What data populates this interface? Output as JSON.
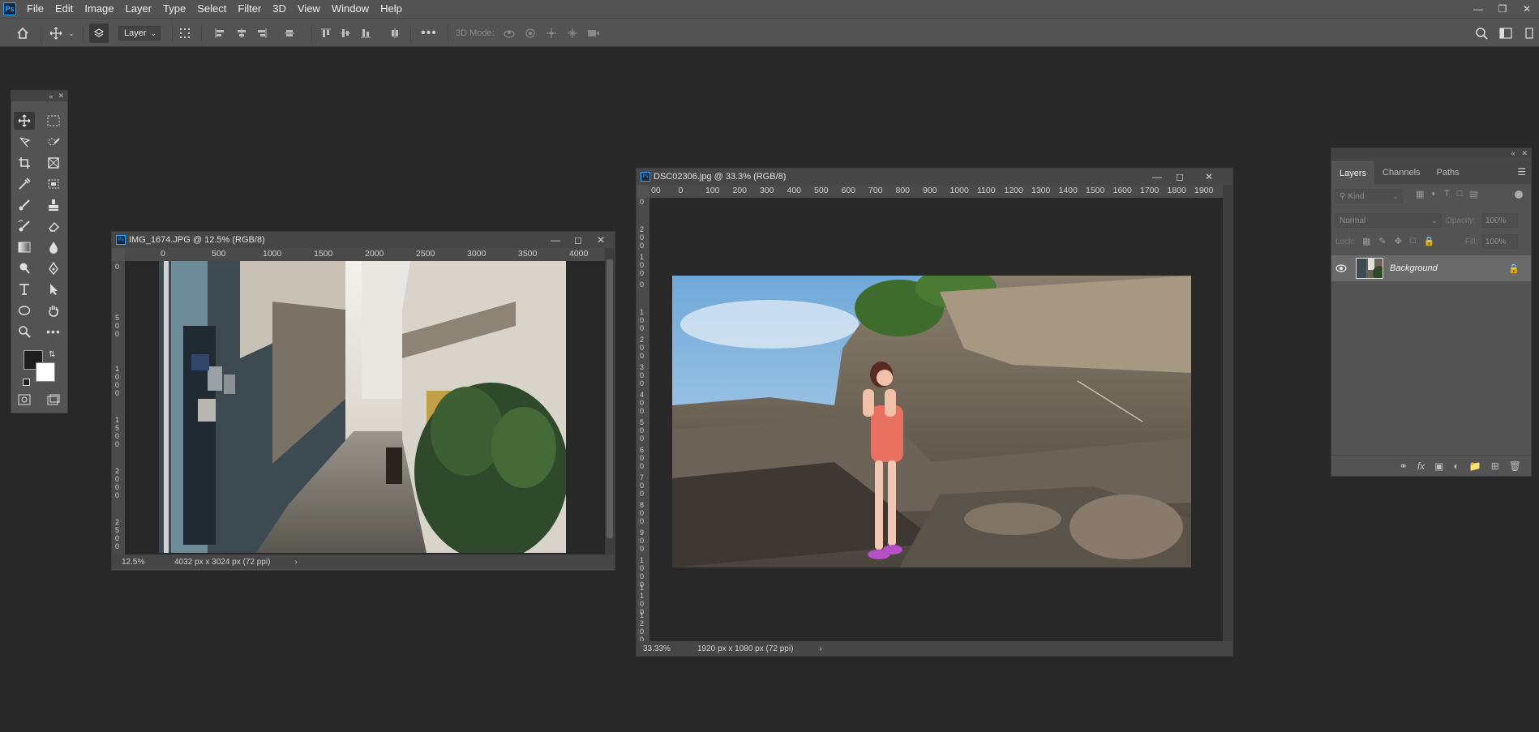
{
  "app": {
    "logo": "Ps"
  },
  "menu": [
    "File",
    "Edit",
    "Image",
    "Layer",
    "Type",
    "Select",
    "Filter",
    "3D",
    "View",
    "Window",
    "Help"
  ],
  "window_controls": [
    "minimize-icon",
    "restore-icon",
    "close-icon"
  ],
  "options_bar": {
    "auto_select_target": "Layer",
    "three_d_mode_label": "3D Mode:",
    "icons": [
      "home-icon",
      "move-icon",
      "layers-auto-select-icon",
      "distribute-icon",
      "align-left-icon",
      "align-horizontal-center-icon",
      "align-right-icon",
      "align-top-icon",
      "align-vertical-center-icon",
      "align-bottom-icon",
      "more-icon",
      "orbit-3d-icon",
      "roll-3d-icon",
      "pan-3d-icon",
      "slide-3d-icon",
      "scale-3d-icon",
      "search-icon",
      "workspace-icon"
    ]
  },
  "toolbox": {
    "tools": [
      "move-tool",
      "marquee-tool",
      "lasso-tool",
      "quick-selection-tool",
      "crop-tool",
      "frame-tool",
      "eyedropper-tool",
      "patch-tool",
      "brush-tool",
      "stamp-tool",
      "history-brush-tool",
      "eraser-tool",
      "gradient-tool",
      "blur-tool",
      "dodge-tool",
      "pen-tool",
      "type-tool",
      "path-selection-tool",
      "ellipse-tool",
      "hand-tool",
      "zoom-tool",
      "more-tools",
      "quick-mask",
      "screen-mode"
    ],
    "foreground_color": "#1e1e1e",
    "background_color": "#ffffff"
  },
  "doc1": {
    "title": "IMG_1674.JPG @ 12.5% (RGB/8)",
    "zoom": "12.5%",
    "info": "4032 px x 3024 px (72 ppi)",
    "ruler_top": [
      "0",
      "500",
      "1000",
      "1500",
      "2000",
      "2500",
      "3000",
      "3500",
      "4000"
    ],
    "ruler_left": [
      "0",
      "500",
      "1000",
      "1500",
      "2000",
      "2500"
    ]
  },
  "doc2": {
    "title": "DSC02306.jpg @ 33.3% (RGB/8)",
    "zoom": "33.33%",
    "info": "1920 px x 1080 px (72 ppi)",
    "ruler_top": [
      "00",
      "0",
      "100",
      "200",
      "300",
      "400",
      "500",
      "600",
      "700",
      "800",
      "900",
      "1000",
      "1100",
      "1200",
      "1300",
      "1400",
      "1500",
      "1600",
      "1700",
      "1800",
      "1900"
    ],
    "ruler_left": [
      "0",
      "200",
      "100",
      "0",
      "100",
      "200",
      "300",
      "400",
      "500",
      "600",
      "700",
      "800",
      "900",
      "1000",
      "1100",
      "1200"
    ]
  },
  "layers_panel": {
    "tabs": [
      "Layers",
      "Channels",
      "Paths"
    ],
    "active_tab": "Layers",
    "filter_label": "Kind",
    "blend_mode": "Normal",
    "opacity_label": "Opacity:",
    "opacity_value": "100%",
    "lock_label": "Lock:",
    "fill_label": "Fill:",
    "fill_value": "100%",
    "layers": [
      {
        "name": "Background",
        "visible": true,
        "locked": true
      }
    ],
    "footer_icons": [
      "link-icon",
      "fx-icon",
      "mask-icon",
      "adjustment-icon",
      "group-icon",
      "new-layer-icon",
      "delete-icon"
    ]
  }
}
